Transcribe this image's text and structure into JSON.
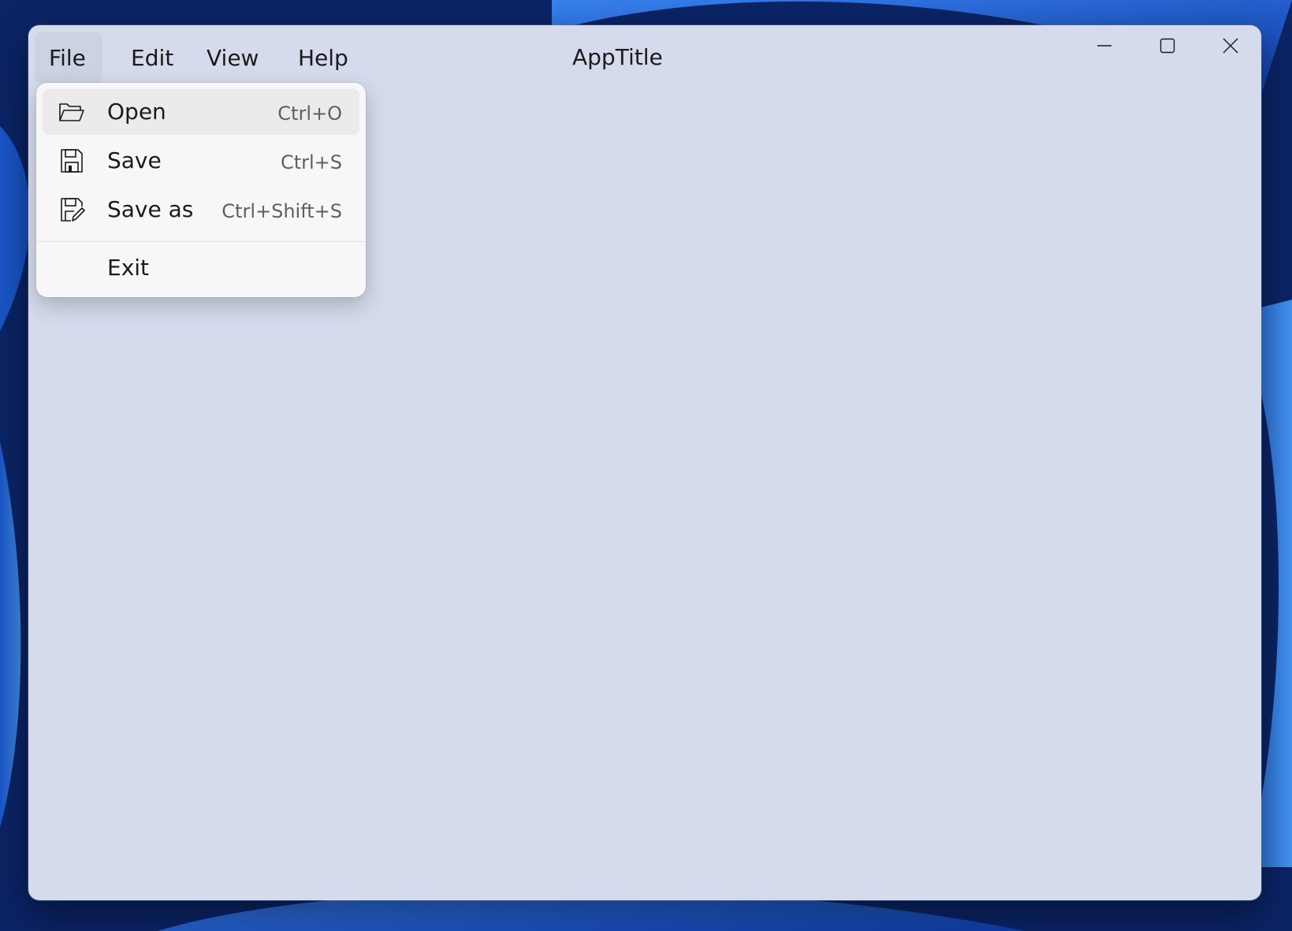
{
  "window": {
    "title": "AppTitle"
  },
  "menubar": {
    "items": [
      {
        "label": "File",
        "active": true
      },
      {
        "label": "Edit"
      },
      {
        "label": "View"
      },
      {
        "label": "Help"
      }
    ]
  },
  "file_menu": {
    "items": [
      {
        "label": "Open",
        "shortcut": "Ctrl+O",
        "icon": "folder-open-icon"
      },
      {
        "label": "Save",
        "shortcut": "Ctrl+S",
        "icon": "save-icon"
      },
      {
        "label": "Save as",
        "shortcut": "Ctrl+Shift+S",
        "icon": "save-as-icon"
      },
      {
        "label": "Exit"
      }
    ]
  },
  "caption_buttons": {
    "minimize": "minimize-icon",
    "maximize": "maximize-icon",
    "close": "close-icon"
  },
  "colors": {
    "window_background": "#d5dbec",
    "menu_background": "#f7f7f9",
    "active_menu_background": "#cbd2e3"
  }
}
